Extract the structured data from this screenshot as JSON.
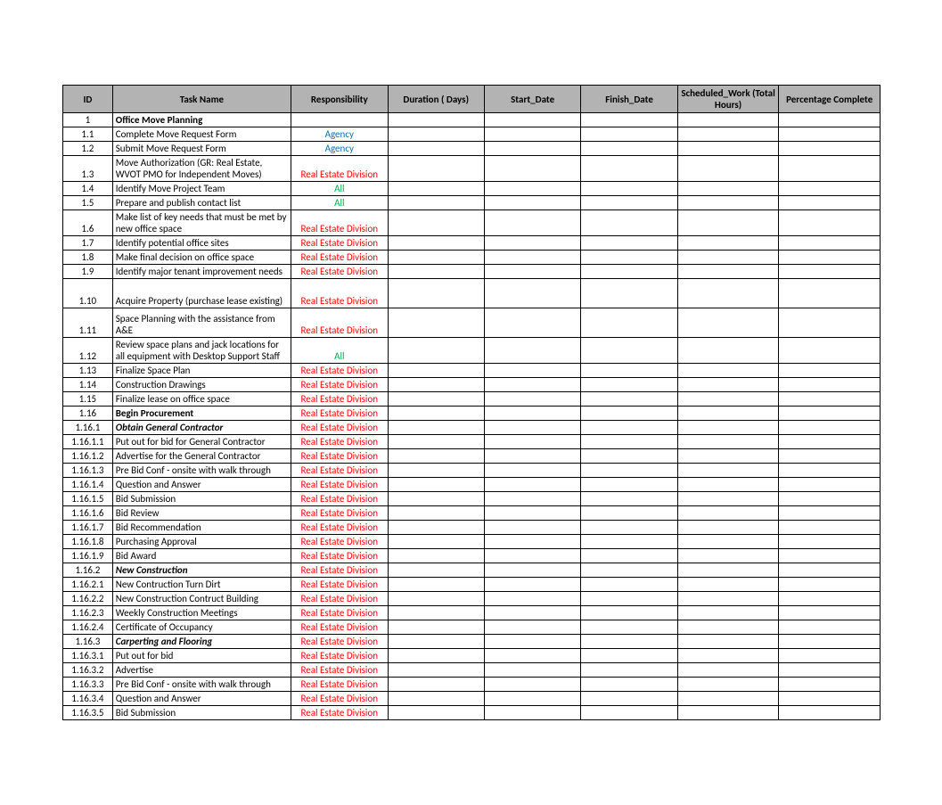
{
  "headers": {
    "id": "ID",
    "task": "Task Name",
    "resp": "Responsibility",
    "dur": "Duration ( Days)",
    "start": "Start_Date",
    "finish": "Finish_Date",
    "sched": "Scheduled_Work (Total Hours)",
    "pct": "Percentage Complete"
  },
  "rows": [
    {
      "id": "1",
      "task": "Office Move Planning",
      "resp": "",
      "taskClass": "bold",
      "respClass": ""
    },
    {
      "id": "1.1",
      "task": "Complete Move Request Form",
      "resp": "Agency",
      "respClass": "resp-agency"
    },
    {
      "id": "1.2",
      "task": "Submit Move Request Form",
      "resp": "Agency",
      "respClass": "resp-agency"
    },
    {
      "id": "1.3",
      "task": "Move Authorization (GR: Real Estate, WVOT PMO for Independent Moves)",
      "resp": "Real Estate Division",
      "respClass": "resp-red",
      "rowClass": "tall"
    },
    {
      "id": "1.4",
      "task": "Identify Move Project Team",
      "resp": "All",
      "respClass": "resp-all"
    },
    {
      "id": "1.5",
      "task": "Prepare and publish contact list",
      "resp": "All",
      "respClass": "resp-all"
    },
    {
      "id": "1.6",
      "task": "Make list of key needs that must be met by new office space",
      "resp": "Real Estate Division",
      "respClass": "resp-red",
      "rowClass": "tall"
    },
    {
      "id": "1.7",
      "task": "Identify potential office sites",
      "resp": "Real Estate Division",
      "respClass": "resp-red"
    },
    {
      "id": "1.8",
      "task": "Make final decision on office space",
      "resp": "Real Estate Division",
      "respClass": "resp-red"
    },
    {
      "id": "1.9",
      "task": "Identify major tenant improvement needs",
      "resp": "Real Estate Division",
      "respClass": "resp-red"
    },
    {
      "id": "1.10",
      "task": "Acquire Property (purchase lease existing)",
      "resp": "Real Estate Division",
      "respClass": "resp-red",
      "rowClass": "taller"
    },
    {
      "id": "1.11",
      "task": "Space Planning with the assistance from A&E",
      "resp": "Real Estate Division",
      "respClass": "resp-red",
      "rowClass": "taller"
    },
    {
      "id": "1.12",
      "task": "Review space plans and jack locations for all equipment with Desktop Support Staff",
      "resp": "All",
      "respClass": "resp-all",
      "rowClass": "tall"
    },
    {
      "id": "1.13",
      "task": "Finalize Space Plan",
      "resp": "Real Estate Division",
      "respClass": "resp-red"
    },
    {
      "id": "1.14",
      "task": "Construction Drawings",
      "resp": "Real Estate Division",
      "respClass": "resp-red"
    },
    {
      "id": "1.15",
      "task": "Finalize lease on office space",
      "resp": "Real Estate Division",
      "respClass": "resp-red"
    },
    {
      "id": "1.16",
      "task": "Begin Procurement",
      "resp": "Real Estate Division",
      "taskClass": "bold",
      "respClass": "resp-red"
    },
    {
      "id": "1.16.1",
      "task": "Obtain General Contractor",
      "resp": "Real Estate Division",
      "taskClass": "bold italic",
      "respClass": "resp-red"
    },
    {
      "id": "1.16.1.1",
      "task": "Put out for bid for General Contractor",
      "resp": "Real Estate Division",
      "respClass": "resp-red"
    },
    {
      "id": "1.16.1.2",
      "task": "Advertise for the General Contractor",
      "resp": "Real Estate Division",
      "respClass": "resp-red"
    },
    {
      "id": "1.16.1.3",
      "task": "Pre Bid Conf - onsite with walk through",
      "resp": "Real Estate Division",
      "respClass": "resp-red"
    },
    {
      "id": "1.16.1.4",
      "task": "Question and Answer",
      "resp": "Real Estate Division",
      "respClass": "resp-red"
    },
    {
      "id": "1.16.1.5",
      "task": "Bid Submission",
      "resp": "Real Estate Division",
      "respClass": "resp-red"
    },
    {
      "id": "1.16.1.6",
      "task": "Bid Review",
      "resp": "Real Estate Division",
      "respClass": "resp-red"
    },
    {
      "id": "1.16.1.7",
      "task": "Bid Recommendation",
      "resp": "Real Estate Division",
      "respClass": "resp-red"
    },
    {
      "id": "1.16.1.8",
      "task": "Purchasing Approval",
      "resp": "Real Estate Division",
      "respClass": "resp-red"
    },
    {
      "id": "1.16.1.9",
      "task": "Bid Award",
      "resp": "Real Estate Division",
      "respClass": "resp-red"
    },
    {
      "id": "1.16.2",
      "task": "New Construction",
      "resp": "Real Estate Division",
      "taskClass": "bold italic",
      "respClass": "resp-red"
    },
    {
      "id": "1.16.2.1",
      "task": "New Contruction Turn Dirt",
      "resp": "Real Estate Division",
      "respClass": "resp-red"
    },
    {
      "id": "1.16.2.2",
      "task": "New Construction Contruct Building",
      "resp": "Real Estate Division",
      "respClass": "resp-red"
    },
    {
      "id": "1.16.2.3",
      "task": "Weekly Construction Meetings",
      "resp": "Real Estate Division",
      "respClass": "resp-red"
    },
    {
      "id": "1.16.2.4",
      "task": "Certificate of Occupancy",
      "resp": "Real Estate Division",
      "respClass": "resp-red"
    },
    {
      "id": "1.16.3",
      "task": "Carperting and Flooring",
      "resp": "Real Estate Division",
      "taskClass": "bold italic",
      "respClass": "resp-red"
    },
    {
      "id": "1.16.3.1",
      "task": "Put out for bid",
      "resp": "Real Estate Division",
      "respClass": "resp-red"
    },
    {
      "id": "1.16.3.2",
      "task": "Advertise",
      "resp": "Real Estate Division",
      "respClass": "resp-red"
    },
    {
      "id": "1.16.3.3",
      "task": "Pre Bid Conf - onsite with walk through",
      "resp": "Real Estate Division",
      "respClass": "resp-red"
    },
    {
      "id": "1.16.3.4",
      "task": "Question and Answer",
      "resp": "Real Estate Division",
      "respClass": "resp-red"
    },
    {
      "id": "1.16.3.5",
      "task": "Bid Submission",
      "resp": "Real Estate Division",
      "respClass": "resp-red"
    }
  ]
}
